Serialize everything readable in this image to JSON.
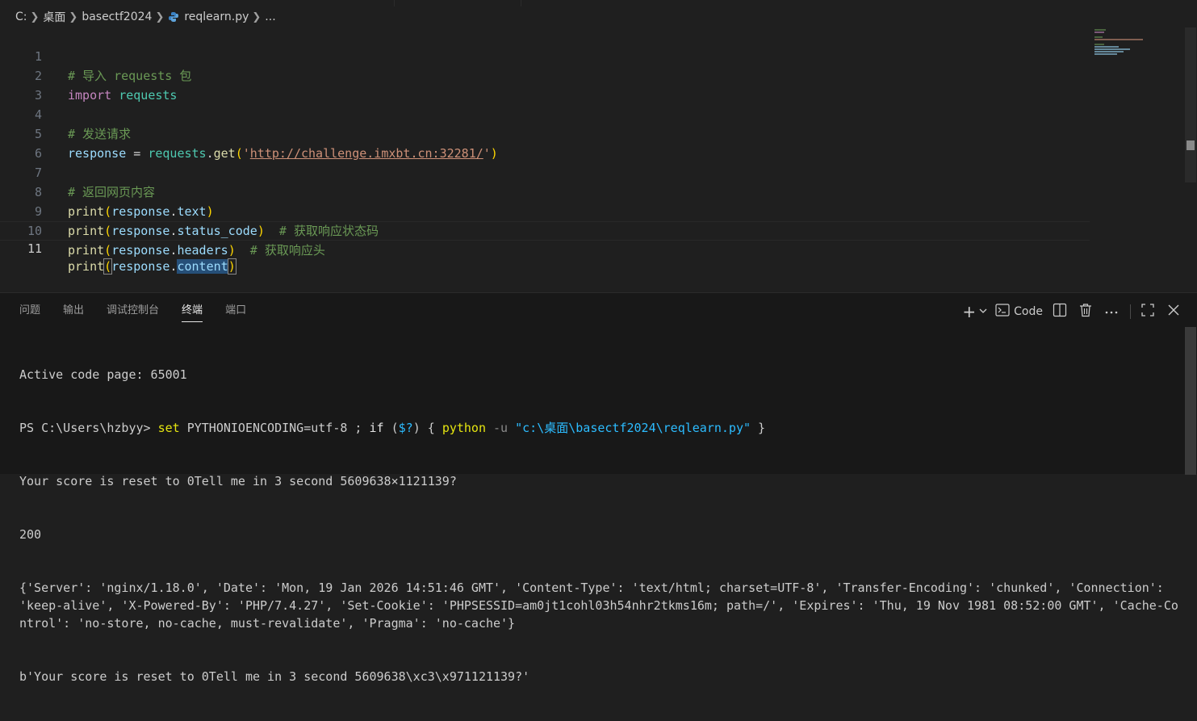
{
  "breadcrumb": {
    "drive": "C:",
    "folder1": "桌面",
    "folder2": "basectf2024",
    "file": "reqlearn.py",
    "more": "..."
  },
  "editor": {
    "lines": [
      {
        "no": "1"
      },
      {
        "no": "2"
      },
      {
        "no": "3"
      },
      {
        "no": "4"
      },
      {
        "no": "5"
      },
      {
        "no": "6"
      },
      {
        "no": "7"
      },
      {
        "no": "8"
      },
      {
        "no": "9"
      },
      {
        "no": "10"
      },
      {
        "no": "11"
      }
    ],
    "code": {
      "l1_comment": "# 导入 requests 包",
      "l2_kw": "import",
      "l2_mod": "requests",
      "l4_comment": "# 发送请求",
      "l5_var": "response",
      "l5_eq": " = ",
      "l5_mod": "requests",
      "l5_dot": ".",
      "l5_func": "get",
      "l5_open": "(",
      "l5_q1": "'",
      "l5_url": "http://challenge.imxbt.cn:32281/",
      "l5_q2": "'",
      "l5_close": ")",
      "l7_comment": "# 返回网页内容",
      "print": "print",
      "open": "(",
      "close": ")",
      "response": "response",
      "dot": ".",
      "l8_attr": "text",
      "l9_attr": "status_code",
      "l9_comment": "  # 获取响应状态码",
      "l10_attr": "headers",
      "l10_comment": "  # 获取响应头",
      "l11_attr": "content"
    }
  },
  "panel": {
    "tabs": [
      "问题",
      "输出",
      "调试控制台",
      "终端",
      "端口"
    ],
    "active_tab": "终端",
    "actions": {
      "add": "+",
      "code_label": "Code"
    }
  },
  "terminal": {
    "line1": "Active code page: 65001",
    "line2_prompt": "PS C:\\Users\\hzbyy> ",
    "line2_set": "set",
    "line2_env": " PYTHONIOENCODING=utf-8 ; ",
    "line2_if": "if",
    "line2_cond_open": " (",
    "line2_cond": "$?",
    "line2_cond_close": ") { ",
    "line2_python": "python",
    "line2_flag": " -u ",
    "line2_path": "\"c:\\桌面\\basectf2024\\reqlearn.py\"",
    "line2_end": " }",
    "line3": "Your score is reset to 0Tell me in 3 second 5609638×1121139?",
    "line4": "200",
    "line5": "{'Server': 'nginx/1.18.0', 'Date': 'Mon, 19 Jan 2026 14:51:46 GMT', 'Content-Type': 'text/html; charset=UTF-8', 'Transfer-Encoding': 'chunked', 'Connection': 'keep-alive', 'X-Powered-By': 'PHP/7.4.27', 'Set-Cookie': 'PHPSESSID=am0jt1cohl03h54nhr2tkms16m; path=/', 'Expires': 'Thu, 19 Nov 1981 08:52:00 GMT', 'Cache-Control': 'no-store, no-cache, must-revalidate', 'Pragma': 'no-cache'}",
    "line6": "b'Your score is reset to 0Tell me in 3 second 5609638\\xc3\\x971121139?'"
  },
  "colors": {
    "editor_bg": "#1f1f1f",
    "panel_bg": "#181818",
    "comment": "#6a9955",
    "keyword": "#c586c0",
    "module": "#4ec9b0",
    "variable": "#9cdcfe",
    "function": "#dcdcaa",
    "string": "#ce9178"
  }
}
